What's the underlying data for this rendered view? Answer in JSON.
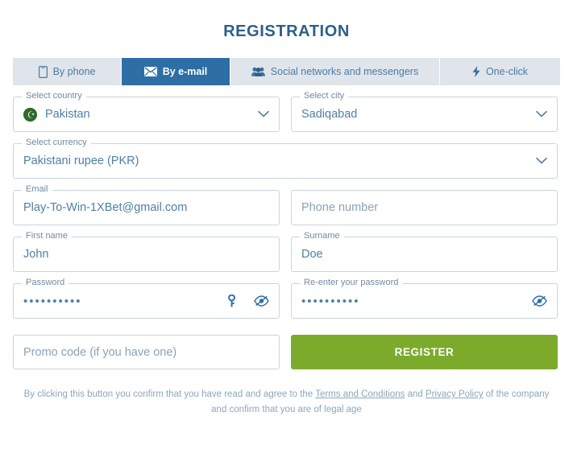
{
  "header": {
    "title": "REGISTRATION"
  },
  "tabs": [
    {
      "label": "By phone",
      "icon": "mobile-phone-icon",
      "active": false
    },
    {
      "label": "By e-mail",
      "icon": "envelope-icon",
      "active": true
    },
    {
      "label": "Social networks and messengers",
      "icon": "people-group-icon",
      "active": false
    },
    {
      "label": "One-click",
      "icon": "lightning-bolt-icon",
      "active": false
    }
  ],
  "form": {
    "country": {
      "label": "Select country",
      "value": "Pakistan",
      "flag": "pakistan-flag-icon"
    },
    "city": {
      "label": "Select city",
      "value": "Sadiqabad"
    },
    "currency": {
      "label": "Select currency",
      "value": "Pakistani rupee (PKR)"
    },
    "email": {
      "label": "Email",
      "value": "Play-To-Win-1XBet@gmail.com"
    },
    "phone": {
      "placeholder": "Phone number",
      "value": ""
    },
    "first_name": {
      "label": "First name",
      "value": "John"
    },
    "surname": {
      "label": "Surname",
      "value": "Doe"
    },
    "password": {
      "label": "Password",
      "value": "••••••••••"
    },
    "confirm_password": {
      "label": "Re-enter your password",
      "value": "••••••••••"
    },
    "promo": {
      "placeholder": "Promo code (if you have one)",
      "value": ""
    }
  },
  "actions": {
    "register_label": "REGISTER"
  },
  "footer": {
    "text_before": "By clicking this button you confirm that you have read and agree to the ",
    "terms_link": "Terms and Conditions",
    "text_middle": " and ",
    "privacy_link": "Privacy Policy",
    "text_after": " of the company and confirm that you are of legal age"
  },
  "colors": {
    "title": "#2c5f8a",
    "active_tab": "#2d6ea5",
    "tab_bar": "#dfe5ea",
    "register_button": "#7cab2c",
    "field_border": "#c7d5e0",
    "text": "#4f7fa6",
    "flag_green": "#2f6b2a"
  }
}
